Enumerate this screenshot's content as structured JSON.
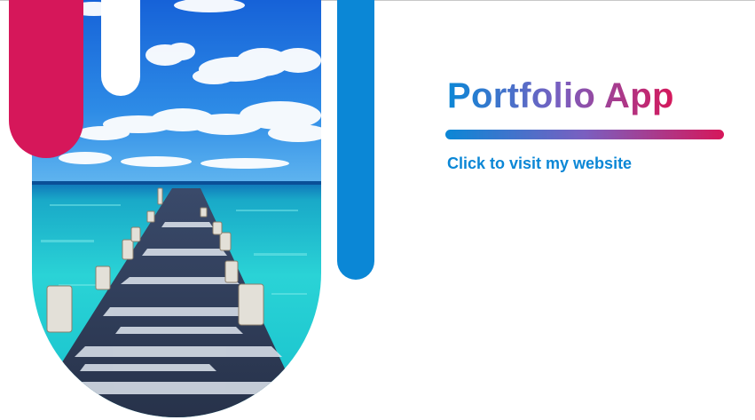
{
  "header": {
    "title": "Portfolio App"
  },
  "main": {
    "link_label": "Click to visit my website"
  },
  "hero_image": {
    "description_icon": "tropical-pier-photo"
  },
  "colors": {
    "accent_red": "#d6175a",
    "accent_blue": "#0b87d6",
    "accent_purple": "#7a5fc0",
    "sea": "#2fd0d4",
    "sky": "#1e7fe0"
  }
}
